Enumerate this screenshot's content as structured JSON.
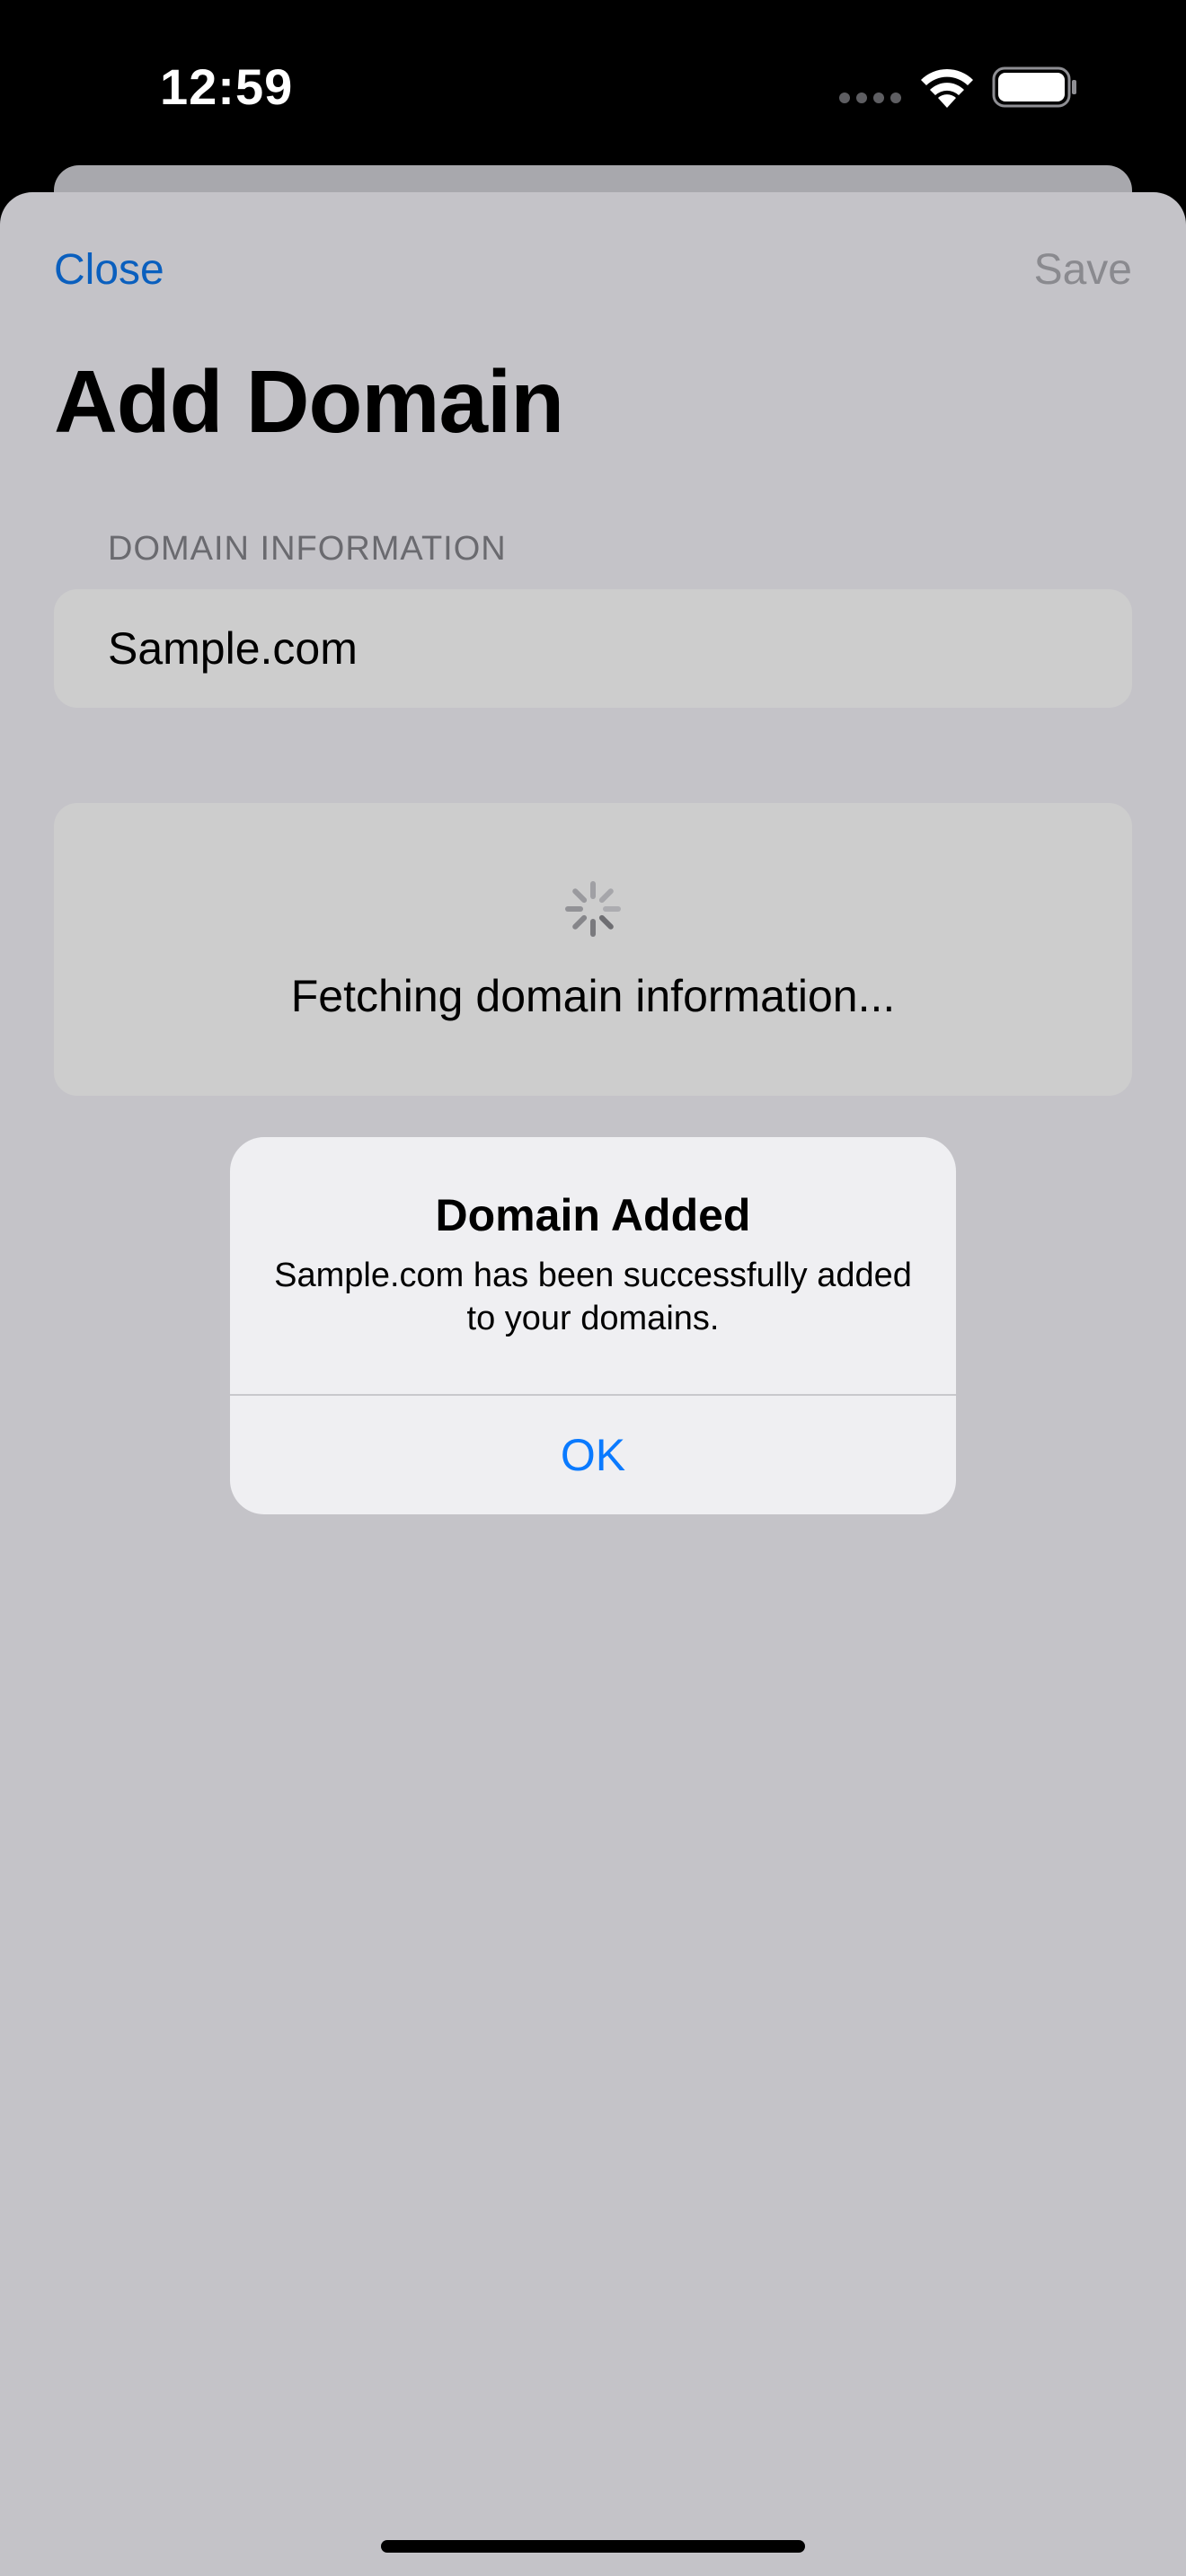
{
  "status_bar": {
    "time": "12:59"
  },
  "nav": {
    "close_label": "Close",
    "save_label": "Save"
  },
  "page": {
    "title": "Add Domain"
  },
  "domain_section": {
    "header": "DOMAIN INFORMATION",
    "field_value": "Sample.com"
  },
  "fetch_card": {
    "status_text": "Fetching domain information..."
  },
  "alert": {
    "title": "Domain Added",
    "message": "Sample.com has been successfully added to your domains.",
    "ok_label": "OK"
  },
  "icons": {
    "wifi": "wifi-icon",
    "battery": "battery-icon",
    "spinner": "spinner-icon",
    "cellular": "cellular-dots-icon"
  },
  "colors": {
    "accent": "#0a7aff",
    "nav_link": "#0a5fbe",
    "disabled": "#8a8a8f",
    "sheet_bg": "#c4c3c8",
    "card_bg": "#cdcdcd",
    "alert_bg": "#efeff2"
  }
}
